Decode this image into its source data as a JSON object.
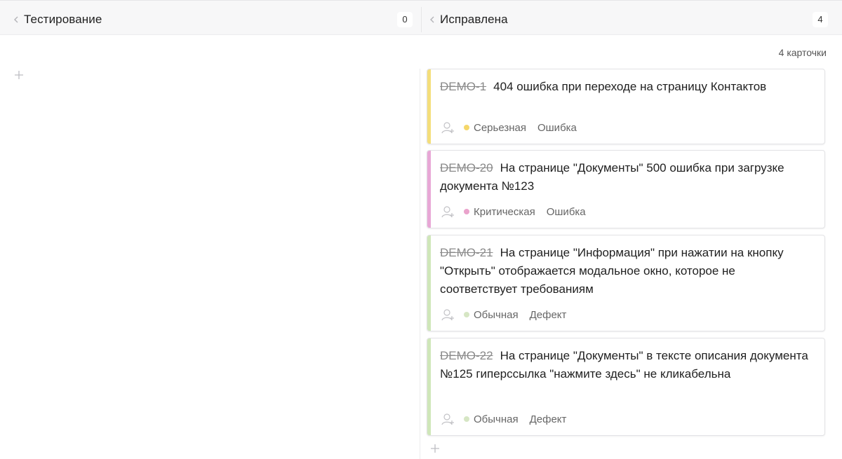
{
  "columns": [
    {
      "title": "Тестирование",
      "count": "0"
    },
    {
      "title": "Исправлена",
      "count": "4"
    }
  ],
  "right_column": {
    "cards_count_label": "4 карточки"
  },
  "cards": [
    {
      "key": "DEMO-1",
      "title": "404 ошибка при переходе на страницу Контактов",
      "priority": "Серьезная",
      "type": "Ошибка",
      "stripe_color": "#f4de7a",
      "dot_color": "#f5d76a"
    },
    {
      "key": "DEMO-20",
      "title": "На странице \"Документы\" 500 ошибка при загрузке документа №123",
      "priority": "Критическая",
      "type": "Ошибка",
      "stripe_color": "#e8a7d6",
      "dot_color": "#eaa3cc"
    },
    {
      "key": "DEMO-21",
      "title": "На странице \"Информация\" при нажатии на кнопку \"Открыть\" отображается модальное окно, которое не соответствует требованиям",
      "priority": "Обычная",
      "type": "Дефект",
      "stripe_color": "#cfe7b9",
      "dot_color": "#d6e6c4"
    },
    {
      "key": "DEMO-22",
      "title": "На странице \"Документы\" в тексте описания документа №125 гиперссылка \"нажмите здесь\" не кликабельна",
      "priority": "Обычная",
      "type": "Дефект",
      "stripe_color": "#cfe7b9",
      "dot_color": "#d6e6c4"
    }
  ],
  "icons": {
    "collapse": "chevron-left-icon",
    "add": "plus-icon",
    "assignee": "user-add-icon"
  }
}
